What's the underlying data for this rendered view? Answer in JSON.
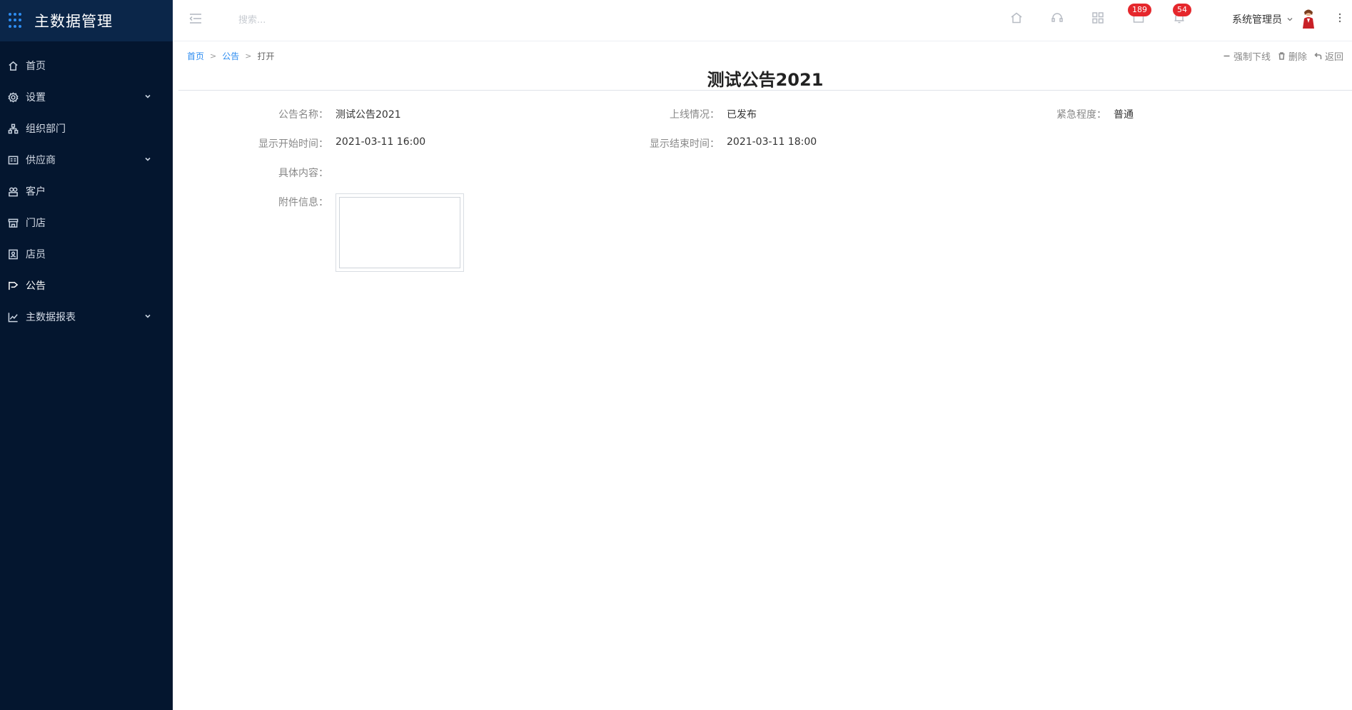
{
  "app": {
    "title": "主数据管理"
  },
  "sidebar": {
    "items": [
      {
        "label": "首页",
        "icon": "home-icon",
        "has_children": false,
        "active": false
      },
      {
        "label": "设置",
        "icon": "gear-icon",
        "has_children": true,
        "active": false
      },
      {
        "label": "组织部门",
        "icon": "org-chart-icon",
        "has_children": false,
        "active": false
      },
      {
        "label": "供应商",
        "icon": "supplier-icon",
        "has_children": true,
        "active": false
      },
      {
        "label": "客户",
        "icon": "customer-icon",
        "has_children": false,
        "active": false
      },
      {
        "label": "门店",
        "icon": "store-icon",
        "has_children": false,
        "active": false
      },
      {
        "label": "店员",
        "icon": "staff-icon",
        "has_children": false,
        "active": false
      },
      {
        "label": "公告",
        "icon": "announcement-icon",
        "has_children": false,
        "active": true
      },
      {
        "label": "主数据报表",
        "icon": "chart-icon",
        "has_children": true,
        "active": false
      }
    ]
  },
  "header": {
    "search_placeholder": "搜索...",
    "messages_badge": "189",
    "notifications_badge": "54",
    "user_name": "系统管理员"
  },
  "breadcrumb": {
    "home": "首页",
    "section": "公告",
    "current": "打开",
    "separator": ">"
  },
  "actions": {
    "force_offline": "强制下线",
    "delete": "删除",
    "back": "返回"
  },
  "notice": {
    "title": "测试公告2021",
    "name_label": "公告名称：",
    "name_value": "测试公告2021",
    "online_label": "上线情况：",
    "online_value": "已发布",
    "urgency_label": "紧急程度：",
    "urgency_value": "普通",
    "start_label": "显示开始时间：",
    "start_value": "2021-03-11 16:00",
    "end_label": "显示结束时间：",
    "end_value": "2021-03-11 18:00",
    "content_label": "具体内容：",
    "content_value": "",
    "attachment_label": "附件信息："
  },
  "colors": {
    "sidebar_bg": "#04162f",
    "brand_bg": "#0b2649",
    "accent": "#2d8cf0",
    "badge": "#e5272c"
  }
}
